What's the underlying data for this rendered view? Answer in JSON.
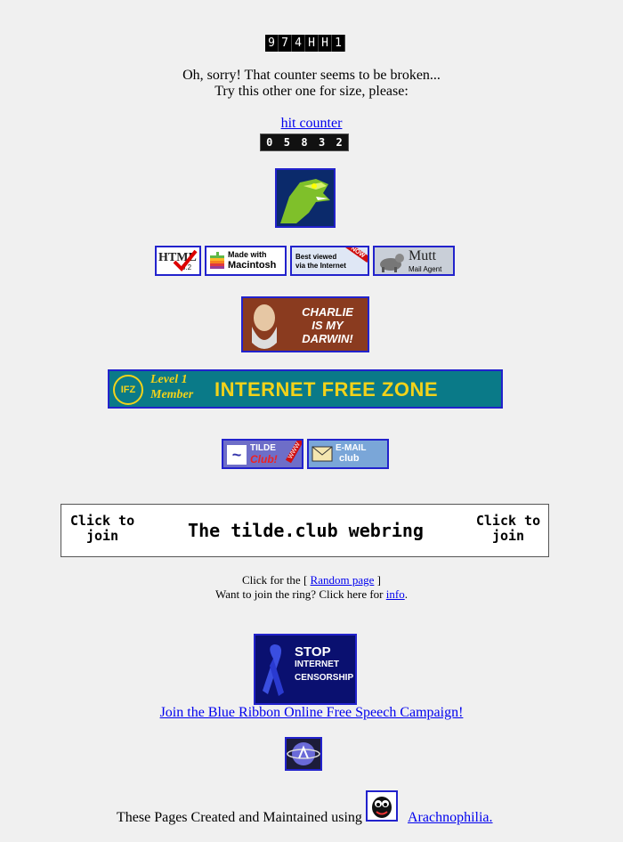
{
  "counter_broken": {
    "digits": [
      "9",
      "7",
      "4",
      "H",
      "H",
      "1"
    ]
  },
  "sorry_line1": "Oh, sorry! That counter seems to be broken...",
  "sorry_line2": "Try this other one for size, please:",
  "hit_counter_link": "hit counter",
  "counter_working": {
    "digits": [
      "0",
      "5",
      "8",
      "3",
      "2"
    ]
  },
  "badges": {
    "html": {
      "big": "HTML",
      "small": "3.2"
    },
    "mac": {
      "line1": "Made with",
      "line2": "Macintosh"
    },
    "best": {
      "line1": "Best viewed",
      "line2": "via the Internet",
      "corner": "NOW"
    },
    "mutt": {
      "line1": "Mutt",
      "line2": "Mail Agent"
    },
    "darwin": {
      "line1": "CHARLIE",
      "line2": "IS MY",
      "line3": "DARWIN!"
    },
    "ifz": {
      "short": "IFZ",
      "level1": "Level 1",
      "level2": "Member",
      "main": "INTERNET FREE ZONE"
    },
    "tilde": {
      "line1": "TILDE",
      "line2": "Club!",
      "corner": "WWW"
    },
    "email": {
      "line1": "E-MAIL",
      "line2": "club"
    }
  },
  "webring": {
    "left_click": "Click to",
    "left_join": "join",
    "title": "The tilde.club webring",
    "right_click": "Click to",
    "right_join": "join"
  },
  "ring_line1_prefix": "Click for the [",
  "ring_random_link": "Random page",
  "ring_line1_suffix": "]",
  "ring_line2_prefix": "Want to join the ring? Click here for",
  "ring_info_link": "info",
  "ring_line2_suffix": ".",
  "ribbon": {
    "line1": "STOP",
    "line2": "INTERNET",
    "line3": "CENSORSHIP"
  },
  "blue_ribbon_link": "Join the Blue Ribbon Online Free Speech Campaign!",
  "footer_text": "These Pages Created and Maintained using",
  "arachnophilia_link": "Arachnophilia."
}
